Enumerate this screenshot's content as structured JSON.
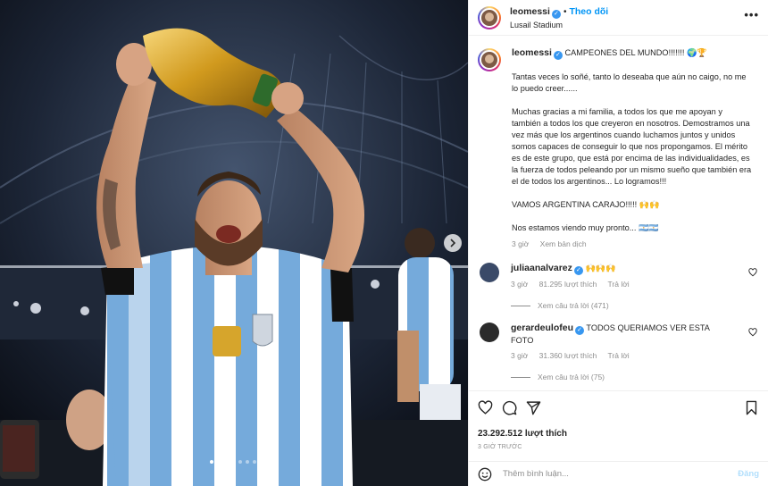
{
  "header": {
    "username": "leomessi",
    "separator": "•",
    "follow_label": "Theo dõi",
    "location": "Lusail Stadium",
    "more_icon": "more-horizontal-icon"
  },
  "caption": {
    "username": "leomessi",
    "title": "CAMPEONES DEL MUNDO!!!!!!! 🌍🏆",
    "paragraphs": [
      "Tantas veces lo soñé, tanto lo deseaba que aún no caigo, no me lo puedo creer......",
      "Muchas gracias a mi familia, a todos los que me apoyan y también a todos los que creyeron en nosotros. Demostramos una vez más que los argentinos cuando luchamos juntos y unidos somos capaces de conseguir lo que nos propongamos. El mérito es de este grupo, que está por encima de las individualidades, es la fuerza de todos peleando por un mismo sueño que también era el de todos los argentinos... Lo logramos!!!",
      "VAMOS ARGENTINA CARAJO!!!!! 🙌🙌",
      "Nos estamos viendo muy pronto... 🇦🇷🇦🇷"
    ],
    "age": "3 giờ",
    "translate_label": "Xem bản dịch"
  },
  "comments": [
    {
      "username": "juliaanalvarez",
      "text": "🙌🙌🙌",
      "age": "3 giờ",
      "likes": "81.295 lượt thích",
      "reply_label": "Trả lời",
      "view_replies": "Xem câu trả lời (471)",
      "avatar_color": "#3a4a68"
    },
    {
      "username": "gerardeulofeu",
      "text": "TODOS QUERIAMOS VER ESTA FOTO",
      "age": "3 giờ",
      "likes": "31.360 lượt thích",
      "reply_label": "Trả lời",
      "view_replies": "Xem câu trả lời (75)",
      "avatar_color": "#2b2b2b"
    }
  ],
  "actions": {
    "like_icon": "heart-icon",
    "comment_icon": "comment-icon",
    "share_icon": "paper-plane-icon",
    "save_icon": "bookmark-icon",
    "likes_count": "23.292.512 lượt thích",
    "posted_time": "3 GIỜ TRƯỚC"
  },
  "composer": {
    "emoji_icon": "emoji-icon",
    "placeholder": "Thêm bình luận...",
    "post_label": "Đăng"
  },
  "carousel": {
    "slide_count": 7,
    "active_index": 0
  },
  "colors": {
    "accent": "#0095f6",
    "verified": "#3897f0",
    "secondary_text": "#8e8e8e",
    "jersey_blue": "#75aadb",
    "trophy_gold": "#d4a017"
  }
}
